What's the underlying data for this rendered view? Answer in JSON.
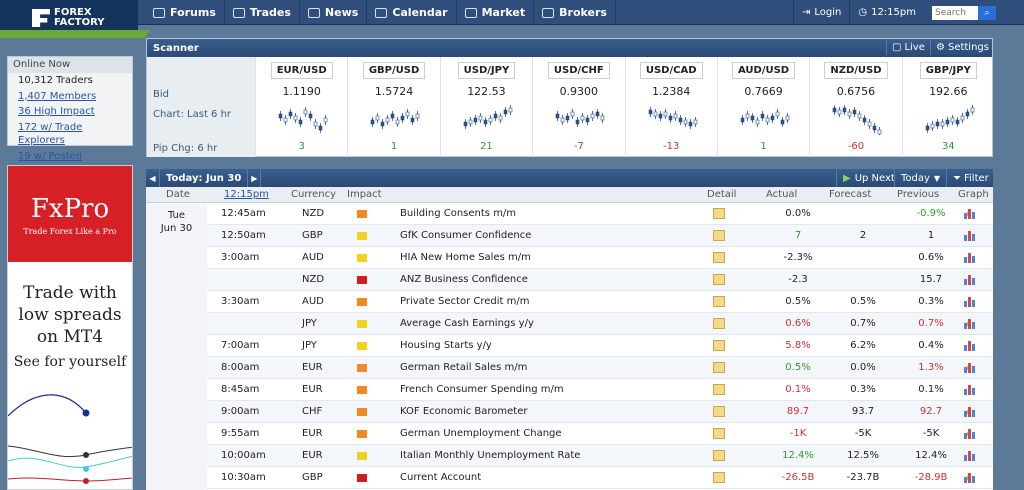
{
  "logo": {
    "line1": "FOREX",
    "line2": "FACTORY"
  },
  "nav": [
    "Forums",
    "Trades",
    "News",
    "Calendar",
    "Market",
    "Brokers"
  ],
  "nav_icons": [
    "forums-icon",
    "trades-icon",
    "news-icon",
    "calendar-icon",
    "market-icon",
    "brokers-icon"
  ],
  "login": "Login",
  "clock": "12:15pm",
  "search_placeholder": "Search",
  "online": {
    "title": "Online Now",
    "traders": "10,312 Traders",
    "members": "1,407 Members",
    "high_impact": "36 High Impact",
    "explorers": "172 w/ Trade Explorers",
    "posted": "19 w/ Posted Systems"
  },
  "ad": {
    "brand": "FxPro",
    "tagline": "Trade Forex Like a Pro",
    "line1": "Trade with",
    "line2": "low spreads",
    "line3": "on MT4",
    "cta": "See for yourself"
  },
  "scanner": {
    "title": "Scanner",
    "live": "Live",
    "settings": "Settings",
    "labels": {
      "bid": "Bid",
      "chart": "Chart: Last 6 hr",
      "pip": "Pip Chg: 6 hr"
    },
    "pairs": [
      {
        "name": "EUR/USD",
        "bid": "1.1190",
        "chg": "3",
        "dir": "pos"
      },
      {
        "name": "GBP/USD",
        "bid": "1.5724",
        "chg": "1",
        "dir": "pos"
      },
      {
        "name": "USD/JPY",
        "bid": "122.53",
        "chg": "21",
        "dir": "pos"
      },
      {
        "name": "USD/CHF",
        "bid": "0.9300",
        "chg": "-7",
        "dir": "neg"
      },
      {
        "name": "USD/CAD",
        "bid": "1.2384",
        "chg": "-13",
        "dir": "neg"
      },
      {
        "name": "AUD/USD",
        "bid": "0.7669",
        "chg": "1",
        "dir": "pos"
      },
      {
        "name": "NZD/USD",
        "bid": "0.6756",
        "chg": "-60",
        "dir": "neg"
      },
      {
        "name": "GBP/JPY",
        "bid": "192.66",
        "chg": "34",
        "dir": "pos"
      }
    ]
  },
  "calendar": {
    "today": "Today: Jun 30",
    "up_next": "Up Next",
    "today_btn": "Today",
    "filter": "Filter",
    "cols": {
      "date": "Date",
      "time": "12:15pm",
      "currency": "Currency",
      "impact": "Impact",
      "detail": "Detail",
      "actual": "Actual",
      "forecast": "Forecast",
      "previous": "Previous",
      "graph": "Graph"
    },
    "day": "Tue",
    "date": "Jun 30",
    "rows": [
      {
        "time": "12:45am",
        "cur": "NZD",
        "imp": "orange",
        "event": "Building Consents m/m",
        "actual": "0.0%",
        "adir": "",
        "forecast": "",
        "previous": "-0.9%",
        "pdir": "pos",
        "rev": true
      },
      {
        "time": "12:50am",
        "cur": "GBP",
        "imp": "yellow",
        "event": "GfK Consumer Confidence",
        "actual": "7",
        "adir": "pos",
        "forecast": "2",
        "previous": "1",
        "pdir": "",
        "rev": false
      },
      {
        "time": "3:00am",
        "cur": "AUD",
        "imp": "yellow",
        "event": "HIA New Home Sales m/m",
        "actual": "-2.3%",
        "adir": "",
        "forecast": "",
        "previous": "0.6%",
        "pdir": "",
        "rev": false
      },
      {
        "time": "",
        "cur": "NZD",
        "imp": "red",
        "event": "ANZ Business Confidence",
        "actual": "-2.3",
        "adir": "",
        "forecast": "",
        "previous": "15.7",
        "pdir": "",
        "rev": false
      },
      {
        "time": "3:30am",
        "cur": "AUD",
        "imp": "orange",
        "event": "Private Sector Credit m/m",
        "actual": "0.5%",
        "adir": "",
        "forecast": "0.5%",
        "previous": "0.3%",
        "pdir": "",
        "rev": false
      },
      {
        "time": "",
        "cur": "JPY",
        "imp": "yellow",
        "event": "Average Cash Earnings y/y",
        "actual": "0.6%",
        "adir": "neg",
        "forecast": "0.7%",
        "previous": "0.7%",
        "pdir": "neg",
        "rev": true
      },
      {
        "time": "7:00am",
        "cur": "JPY",
        "imp": "yellow",
        "event": "Housing Starts y/y",
        "actual": "5.8%",
        "adir": "neg",
        "forecast": "6.2%",
        "previous": "0.4%",
        "pdir": "",
        "rev": false
      },
      {
        "time": "8:00am",
        "cur": "EUR",
        "imp": "orange",
        "event": "German Retail Sales m/m",
        "actual": "0.5%",
        "adir": "pos",
        "forecast": "0.0%",
        "previous": "1.3%",
        "pdir": "neg",
        "rev": true
      },
      {
        "time": "8:45am",
        "cur": "EUR",
        "imp": "orange",
        "event": "French Consumer Spending m/m",
        "actual": "0.1%",
        "adir": "neg",
        "forecast": "0.3%",
        "previous": "0.1%",
        "pdir": "",
        "rev": false
      },
      {
        "time": "9:00am",
        "cur": "CHF",
        "imp": "orange",
        "event": "KOF Economic Barometer",
        "actual": "89.7",
        "adir": "neg",
        "forecast": "93.7",
        "previous": "92.7",
        "pdir": "neg",
        "rev": true
      },
      {
        "time": "9:55am",
        "cur": "EUR",
        "imp": "orange",
        "event": "German Unemployment Change",
        "actual": "-1K",
        "adir": "neg",
        "forecast": "-5K",
        "previous": "-5K",
        "pdir": "",
        "rev": true
      },
      {
        "time": "10:00am",
        "cur": "EUR",
        "imp": "yellow",
        "event": "Italian Monthly Unemployment Rate",
        "actual": "12.4%",
        "adir": "pos",
        "forecast": "12.5%",
        "previous": "12.4%",
        "pdir": "",
        "rev": false
      },
      {
        "time": "10:30am",
        "cur": "GBP",
        "imp": "red",
        "event": "Current Account",
        "actual": "-26.5B",
        "adir": "neg",
        "forecast": "-23.7B",
        "previous": "-28.9B",
        "pdir": "neg",
        "rev": true
      }
    ]
  }
}
